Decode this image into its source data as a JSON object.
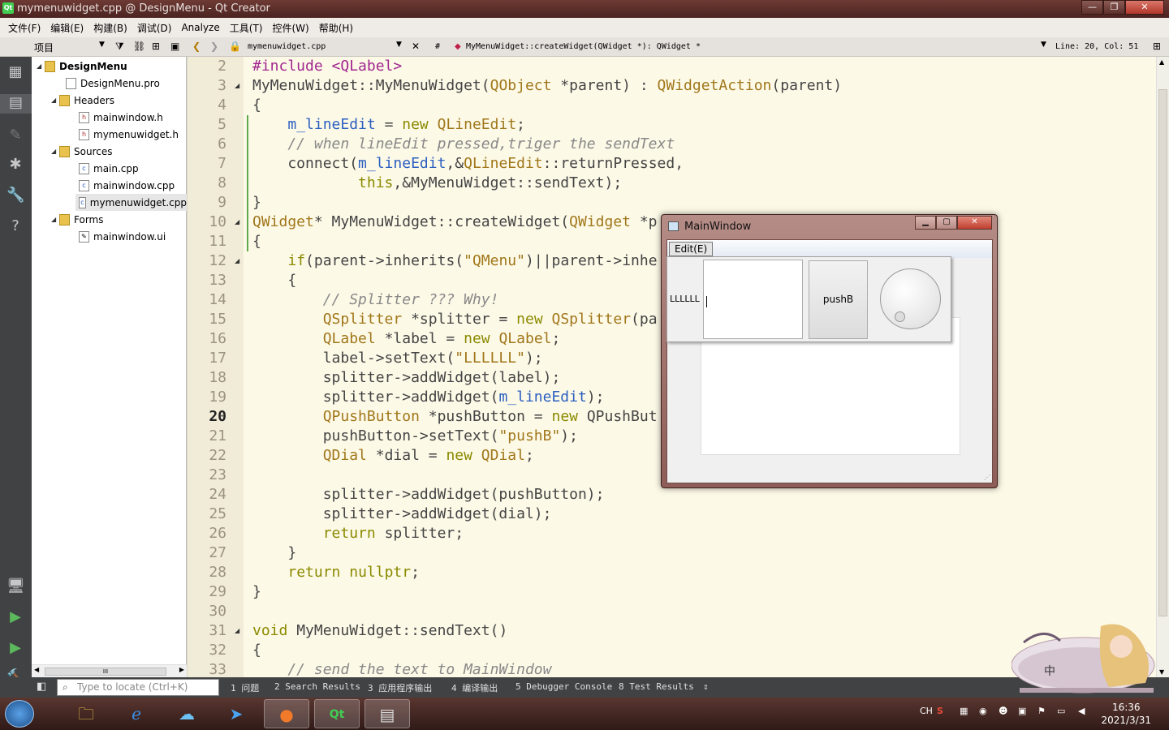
{
  "window": {
    "title": "mymenuwidget.cpp @ DesignMenu - Qt Creator",
    "buttons": [
      "—",
      "❐",
      "✕"
    ]
  },
  "menubar": [
    "文件(F)",
    "编辑(E)",
    "构建(B)",
    "调试(D)",
    "Analyze",
    "工具(T)",
    "控件(W)",
    "帮助(H)"
  ],
  "toolbar": {
    "view_label": "项目",
    "open_file": "mymenuwidget.cpp",
    "symbol": "MyMenuWidget::createWidget(QWidget *): QWidget *",
    "hash": "#",
    "cursor_pos": "Line: 20, Col: 51"
  },
  "tree": {
    "project": "DesignMenu",
    "items": [
      {
        "label": "DesignMenu.pro"
      },
      {
        "label": "Headers"
      },
      {
        "label": "mainwindow.h"
      },
      {
        "label": "mymenuwidget.h"
      },
      {
        "label": "Sources"
      },
      {
        "label": "main.cpp"
      },
      {
        "label": "mainwindow.cpp"
      },
      {
        "label": "mymenuwidget.cpp"
      },
      {
        "label": "Forms"
      },
      {
        "label": "mainwindow.ui"
      }
    ],
    "scroll_grip": "III"
  },
  "editor": {
    "current_line": "20",
    "lines": [
      {
        "n": "2",
        "text": "#include <QLabel>"
      },
      {
        "n": "3",
        "text": "MyMenuWidget::MyMenuWidget(QObject *parent) : QWidgetAction(parent)"
      },
      {
        "n": "4",
        "text": "{"
      },
      {
        "n": "5",
        "text": "    m_lineEdit = new QLineEdit;"
      },
      {
        "n": "6",
        "text": "    // when lineEdit pressed,triger the sendText"
      },
      {
        "n": "7",
        "text": "    connect(m_lineEdit,&QLineEdit::returnPressed,"
      },
      {
        "n": "8",
        "text": "            this,&MyMenuWidget::sendText);"
      },
      {
        "n": "9",
        "text": "}"
      },
      {
        "n": "10",
        "text": "QWidget* MyMenuWidget::createWidget(QWidget *p"
      },
      {
        "n": "11",
        "text": "{"
      },
      {
        "n": "12",
        "text": "    if(parent->inherits(\"QMenu\")||parent->inhe"
      },
      {
        "n": "13",
        "text": "    {"
      },
      {
        "n": "14",
        "text": "        // Splitter ??? Why!"
      },
      {
        "n": "15",
        "text": "        QSplitter *splitter = new QSplitter(pa"
      },
      {
        "n": "16",
        "text": "        QLabel *label = new QLabel;"
      },
      {
        "n": "17",
        "text": "        label->setText(\"LLLLLL\");"
      },
      {
        "n": "18",
        "text": "        splitter->addWidget(label);"
      },
      {
        "n": "19",
        "text": "        splitter->addWidget(m_lineEdit);"
      },
      {
        "n": "20",
        "text": "        QPushButton *pushButton = new QPushBut"
      },
      {
        "n": "21",
        "text": "        pushButton->setText(\"pushB\");"
      },
      {
        "n": "22",
        "text": "        QDial *dial = new QDial;"
      },
      {
        "n": "23",
        "text": ""
      },
      {
        "n": "24",
        "text": "        splitter->addWidget(pushButton);"
      },
      {
        "n": "25",
        "text": "        splitter->addWidget(dial);"
      },
      {
        "n": "26",
        "text": "        return splitter;"
      },
      {
        "n": "27",
        "text": "    }"
      },
      {
        "n": "28",
        "text": "    return nullptr;"
      },
      {
        "n": "29",
        "text": "}"
      },
      {
        "n": "30",
        "text": ""
      },
      {
        "n": "31",
        "text": "void MyMenuWidget::sendText()"
      },
      {
        "n": "32",
        "text": "{"
      },
      {
        "n": "33",
        "text": "    // send the text to MainWindow"
      }
    ]
  },
  "output": {
    "locator_placeholder": "Type to locate (Ctrl+K)",
    "tabs": [
      "1 问题",
      "2 Search Results",
      "3 应用程序输出",
      "4 编译输出",
      "5 Debugger Console",
      "8 Test Results"
    ]
  },
  "mainwindow": {
    "title": "MainWindow",
    "menu_item": "Edit(E)",
    "label_text": "LLLLLL",
    "button_text": "pushB"
  },
  "taskbar": {
    "tray": [
      "CH",
      "S"
    ],
    "time": "16:36",
    "date": "2021/3/31"
  },
  "colors": {
    "keyword": "#8a8a00",
    "type": "#a0771a",
    "member": "#2b5fc0",
    "comment": "#888888",
    "string": "#a0771a",
    "preproc": "#a0268e",
    "change_bar": "#5ea94e"
  }
}
